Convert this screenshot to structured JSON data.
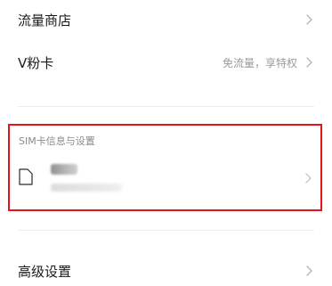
{
  "menu": {
    "traffic_store": {
      "label": "流量商店",
      "icon": "chevron-right-icon"
    },
    "v_card": {
      "label": "V粉卡",
      "value": "免流量，享特权",
      "icon": "chevron-right-icon"
    },
    "advanced": {
      "label": "高级设置",
      "icon": "chevron-right-icon"
    }
  },
  "sim_section": {
    "header": "SIM卡信息与设置",
    "icon": "sim-card-icon",
    "chevron_icon": "chevron-right-icon"
  },
  "colors": {
    "highlight_border": "#e3141b",
    "primary_text": "#1a1a1a",
    "secondary_text": "#9a9a9a",
    "divider": "#ececec"
  }
}
